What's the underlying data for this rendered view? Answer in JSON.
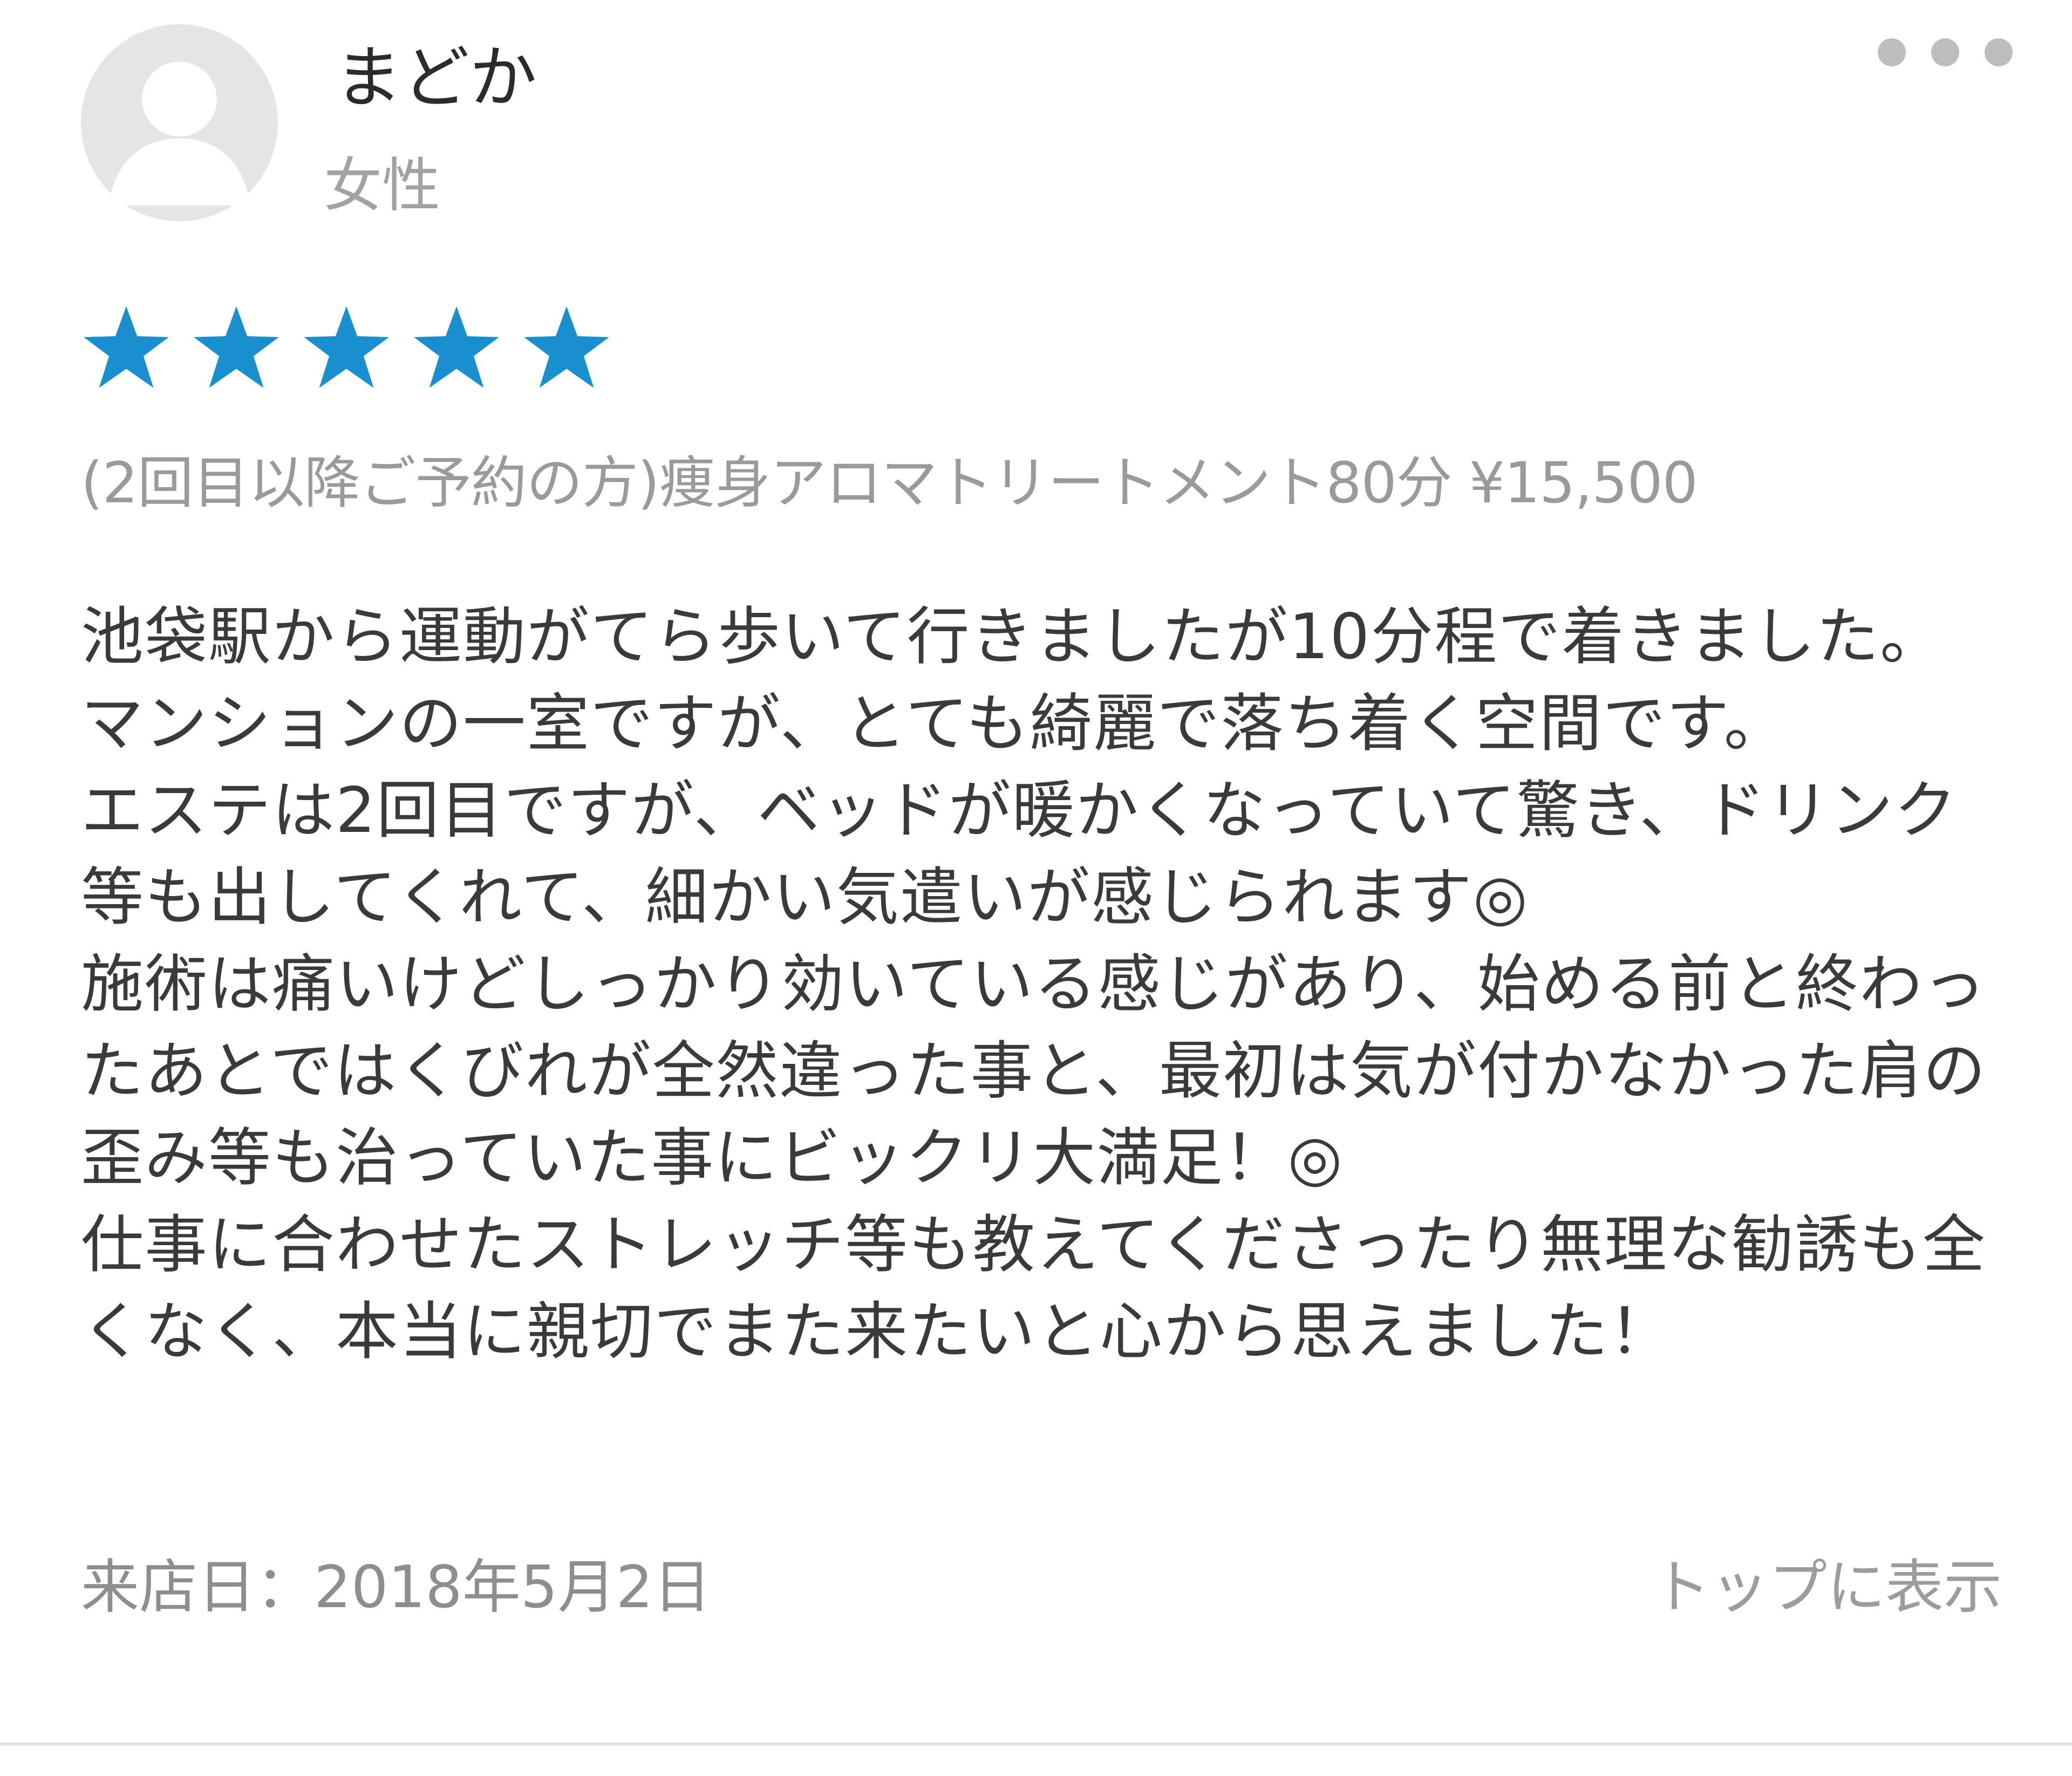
{
  "review": {
    "user": {
      "avatar_icon": "default-user-avatar-icon",
      "name": "まどか",
      "gender": "女性"
    },
    "more_icon": "more-horizontal-icon",
    "rating": {
      "value": 5,
      "max": 5,
      "star_icon": "star-icon",
      "star_color": "#1a8fd0"
    },
    "menu": "(2回目以降ご予約の方)痩身アロマトリートメント80分 ¥15,500",
    "body": "池袋駅から運動がてら歩いて行きましたが10分程で着きました。マンションの一室ですが、とても綺麗で落ち着く空間です。\nエステは2回目ですが、ベッドが暖かくなっていて驚き、ドリンク等も出してくれて、細かい気遣いが感じられます◎\n施術は痛いけどしっかり効いている感じがあり、始める前と終わったあとではくびれが全然違った事と、最初は気が付かなかった肩の歪み等も治っていた事にビックリ大満足！◎\n仕事に合わせたストレッチ等も教えてくださったり無理な勧誘も全くなく、本当に親切でまた来たいと心から思えました！",
    "visit_date": "来店日：2018年5月2日",
    "pin_label": "トップに表示"
  }
}
